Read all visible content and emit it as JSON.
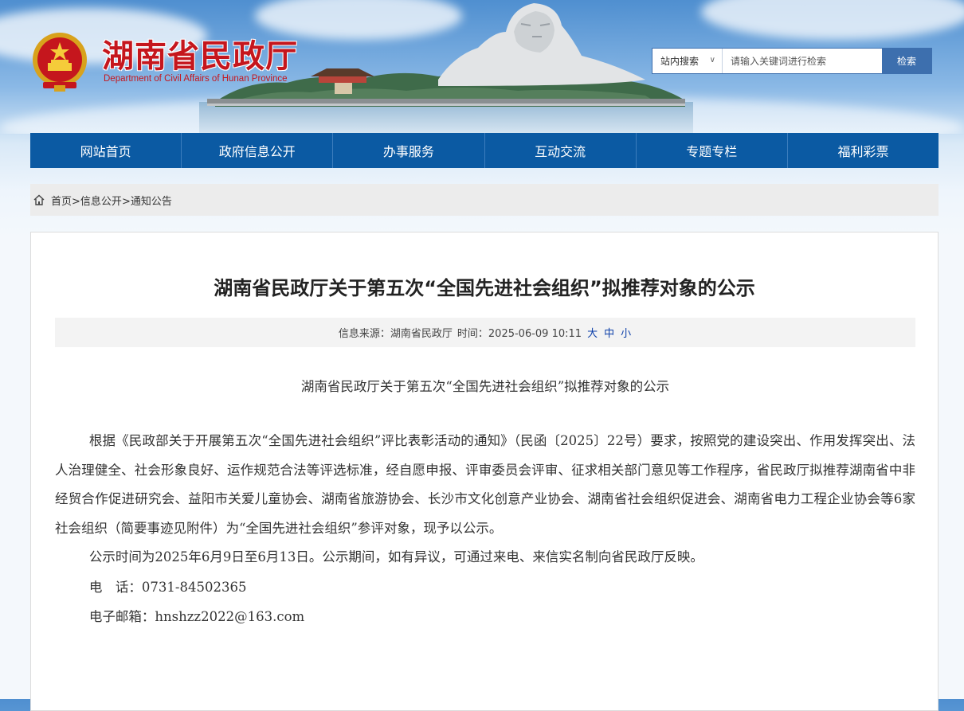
{
  "site": {
    "name_cn": "湖南省民政厅",
    "name_en": "Department of Civil Affairs of Hunan Province"
  },
  "search": {
    "scope": "站内搜索",
    "placeholder": "请输入关键词进行检索",
    "button": "检索"
  },
  "nav": [
    {
      "label": "网站首页"
    },
    {
      "label": "政府信息公开"
    },
    {
      "label": "办事服务"
    },
    {
      "label": "互动交流"
    },
    {
      "label": "专题专栏"
    },
    {
      "label": "福利彩票"
    }
  ],
  "breadcrumb": {
    "home": "首页",
    "level1": "信息公开",
    "level2": "通知公告",
    "separator": ">"
  },
  "article": {
    "title": "湖南省民政厅关于第五次“全国先进社会组织”拟推荐对象的公示",
    "source_label": "信息来源：湖南省民政厅",
    "time_label": "时间：2025-06-09 10:11",
    "font_sizes": [
      "大",
      "中",
      "小"
    ],
    "subtitle": "湖南省民政厅关于第五次“全国先进社会组织”拟推荐对象的公示",
    "paragraphs": [
      "根据《民政部关于开展第五次“全国先进社会组织”评比表彰活动的通知》（民函〔2025〕22号）要求，按照党的建设突出、作用发挥突出、法人治理健全、社会形象良好、运作规范合法等评选标准，经自愿申报、评审委员会评审、征求相关部门意见等工作程序，省民政厅拟推荐湖南省中非经贸合作促进研究会、益阳市关爱儿童协会、湖南省旅游协会、长沙市文化创意产业协会、湖南省社会组织促进会、湖南省电力工程企业协会等6家社会组织（简要事迹见附件）为“全国先进社会组织”参评对象，现予以公示。",
      "公示时间为2025年6月9日至6月13日。公示期间，如有异议，可通过来电、来信实名制向省民政厅反映。"
    ],
    "phone": "电　话：0731-84502365",
    "email": "电子邮箱：hnshzz2022@163.com"
  },
  "colors": {
    "nav_bg": "#0b5aa3",
    "logo_red": "#c5161d",
    "search_btn": "#3d6fae",
    "link_blue": "#0b3ea8"
  },
  "icons": {
    "breadcrumb_home": "home-icon",
    "emblem": "national-emblem-icon",
    "dropdown": "chevron-down-icon"
  }
}
